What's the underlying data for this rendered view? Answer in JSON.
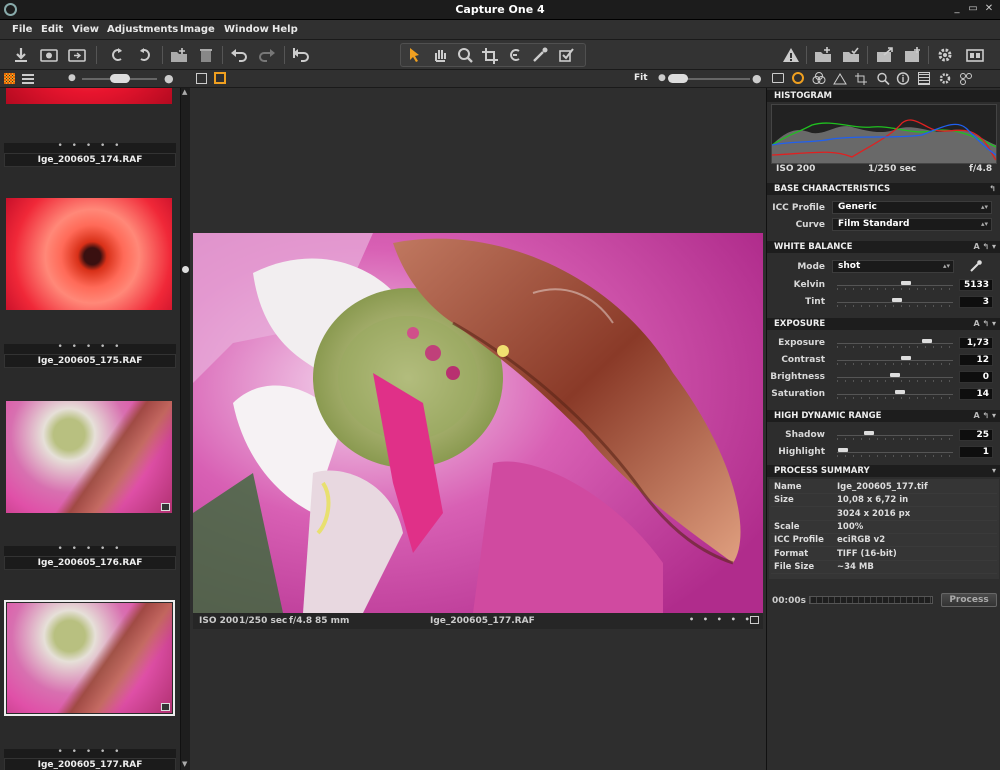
{
  "window": {
    "title": "Capture One 4"
  },
  "menu": [
    "File",
    "Edit",
    "View",
    "Adjustments",
    "Image",
    "Window",
    "Help"
  ],
  "toolbar": {
    "icons": [
      "import-icon",
      "capture-icon",
      "compare-icon",
      "rotate-left-icon",
      "rotate-right-icon",
      "new-folder-icon",
      "trash-icon",
      "undo-icon",
      "redo-icon",
      "reset-icon",
      "select-icon",
      "hand-icon",
      "zoom-icon",
      "crop-icon",
      "straighten-icon",
      "color-picker-icon",
      "checkbox-icon",
      "warning-icon",
      "add-collection-icon",
      "collection-check-icon",
      "export-icon",
      "batch-icon",
      "settings-icon",
      "fullscreen-icon"
    ]
  },
  "browser_bar": {
    "fit_label": "Fit"
  },
  "thumbnails": [
    {
      "name": "Ige_200605_174.RAF",
      "dots": "• • • • •"
    },
    {
      "name": "Ige_200605_175.RAF",
      "dots": "• • • • •"
    },
    {
      "name": "Ige_200605_176.RAF",
      "dots": "• • • • •"
    },
    {
      "name": "Ige_200605_177.RAF",
      "dots": "• • • • •"
    }
  ],
  "viewer": {
    "iso": "ISO 200",
    "shutter": "1/250 sec",
    "aperture": "f/4.8",
    "focal": "85 mm",
    "filename": "Ige_200605_177.RAF",
    "dots": "• • • • •"
  },
  "histogram": {
    "title": "HISTOGRAM",
    "iso": "ISO 200",
    "shutter": "1/250 sec",
    "aperture": "f/4.8"
  },
  "base": {
    "title": "BASE CHARACTERISTICS",
    "icc_label": "ICC Profile",
    "icc_value": "Generic",
    "curve_label": "Curve",
    "curve_value": "Film Standard"
  },
  "white_balance": {
    "title": "WHITE BALANCE",
    "mode_label": "Mode",
    "mode_value": "shot",
    "kelvin_label": "Kelvin",
    "kelvin_value": "5133",
    "tint_label": "Tint",
    "tint_value": "3",
    "kelvin_fraction": 0.6,
    "tint_fraction": 0.52
  },
  "exposure": {
    "title": "EXPOSURE",
    "rows": [
      {
        "label": "Exposure",
        "value": "1,73",
        "fraction": 0.8
      },
      {
        "label": "Contrast",
        "value": "12",
        "fraction": 0.6
      },
      {
        "label": "Brightness",
        "value": "0",
        "fraction": 0.5
      },
      {
        "label": "Saturation",
        "value": "14",
        "fraction": 0.55
      }
    ]
  },
  "hdr": {
    "title": "HIGH DYNAMIC RANGE",
    "rows": [
      {
        "label": "Shadow",
        "value": "25",
        "fraction": 0.25
      },
      {
        "label": "Highlight",
        "value": "1",
        "fraction": 0.01
      }
    ]
  },
  "summary": {
    "title": "PROCESS SUMMARY",
    "rows": [
      {
        "k": "Name",
        "v": "Ige_200605_177.tif"
      },
      {
        "k": "Size",
        "v": "10,08  x  6,72   in"
      },
      {
        "k": "",
        "v": "3024  x  2016   px"
      },
      {
        "k": "Scale",
        "v": "100%"
      },
      {
        "k": "ICC Profile",
        "v": "eciRGB v2"
      },
      {
        "k": "Format",
        "v": "TIFF (16-bit)"
      },
      {
        "k": "File Size",
        "v": "~34 MB"
      }
    ],
    "time": "00:00s",
    "process_label": "Process"
  }
}
